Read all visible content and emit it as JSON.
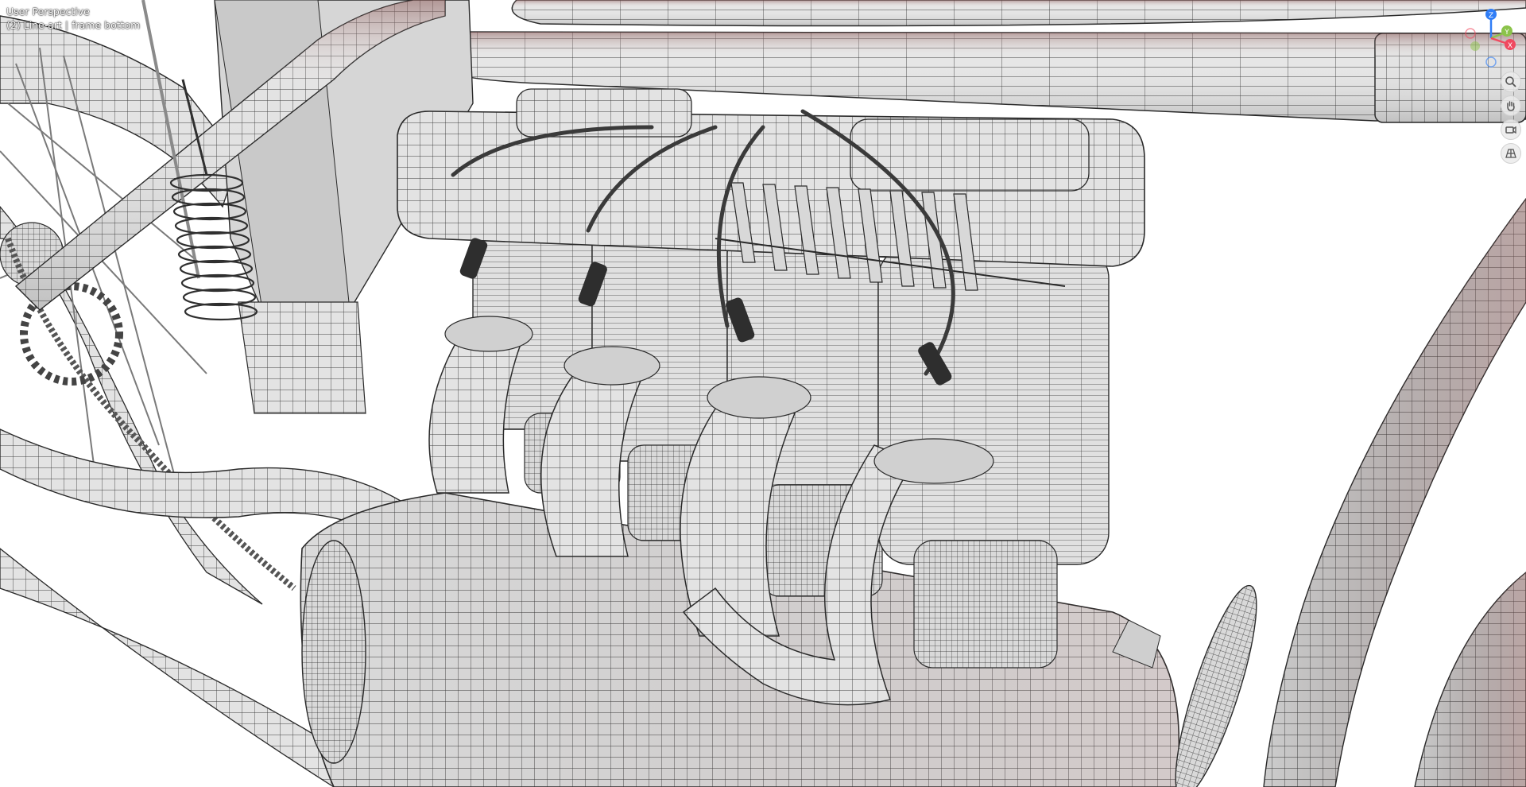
{
  "viewport": {
    "view_name": "User Perspective",
    "collection_label": "(2) Line-art | frame bottom"
  },
  "gizmo": {
    "axes": [
      {
        "label": "Z",
        "color": "#2f7df6"
      },
      {
        "label": "Y",
        "color": "#8bc34a"
      },
      {
        "label": "X",
        "color": "#f0495f"
      }
    ]
  },
  "nav_tools": [
    {
      "name": "zoom-icon"
    },
    {
      "name": "hand-pan-icon"
    },
    {
      "name": "camera-icon"
    },
    {
      "name": "perspective-grid-icon"
    }
  ],
  "colors": {
    "background": "#ffffff",
    "surface": "#e6e6e6",
    "surface_shade": "#bdbdbd",
    "wire": "#3a3a3a",
    "rim_shadow": "#8a5a58"
  }
}
